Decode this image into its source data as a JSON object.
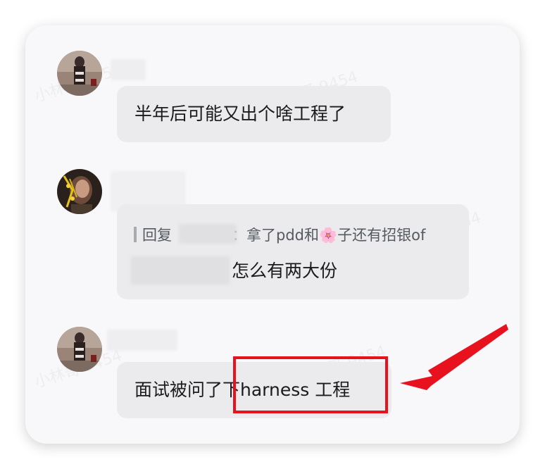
{
  "watermark_text": "小林哥 9454",
  "messages": [
    {
      "text": "半年后可能又出个啥工程了"
    },
    {
      "reply_prefix": "回复",
      "reply_colon": "：",
      "reply_text": "拿了pdd和🌸子还有招银of",
      "text": "怎么有两大份"
    },
    {
      "text": "面试被问了下harness 工程"
    }
  ],
  "colors": {
    "highlight": "#e8121e",
    "bubble": "#ebebed",
    "card": "#f8f8fa"
  }
}
